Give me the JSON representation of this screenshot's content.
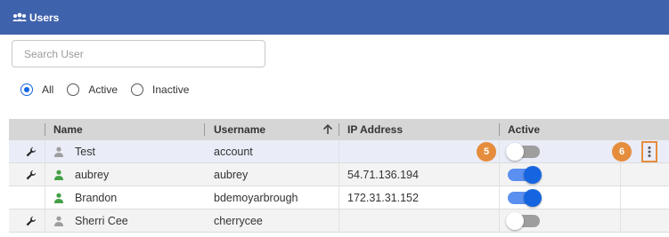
{
  "header": {
    "title": "Users",
    "icon": "users-icon"
  },
  "search": {
    "placeholder": "Search User",
    "value": ""
  },
  "filters": [
    {
      "label": "All",
      "selected": true
    },
    {
      "label": "Active",
      "selected": false
    },
    {
      "label": "Inactive",
      "selected": false
    }
  ],
  "table": {
    "columns": {
      "name": "Name",
      "username": "Username",
      "ip": "IP Address",
      "active": "Active"
    },
    "sort": {
      "column": "Username",
      "direction": "ascending"
    },
    "rows": [
      {
        "name": "Test",
        "username": "account",
        "ip": "",
        "active": false,
        "has_tool": true,
        "user_color": "#9e9e9e"
      },
      {
        "name": "aubrey",
        "username": "aubrey",
        "ip": "54.71.136.194",
        "active": true,
        "has_tool": true,
        "user_color": "#43a047"
      },
      {
        "name": "Brandon",
        "username": "bdemoyarbrough",
        "ip": "172.31.31.152",
        "active": true,
        "has_tool": false,
        "user_color": "#43a047"
      },
      {
        "name": "Sherri Cee",
        "username": "cherrycee",
        "ip": "",
        "active": false,
        "has_tool": true,
        "user_color": "#9e9e9e"
      }
    ]
  },
  "badges": {
    "toggle": "5",
    "menu": "6"
  },
  "colors": {
    "header": "#3f62ad",
    "accent": "#1565e0",
    "badge": "#e58d3d"
  }
}
